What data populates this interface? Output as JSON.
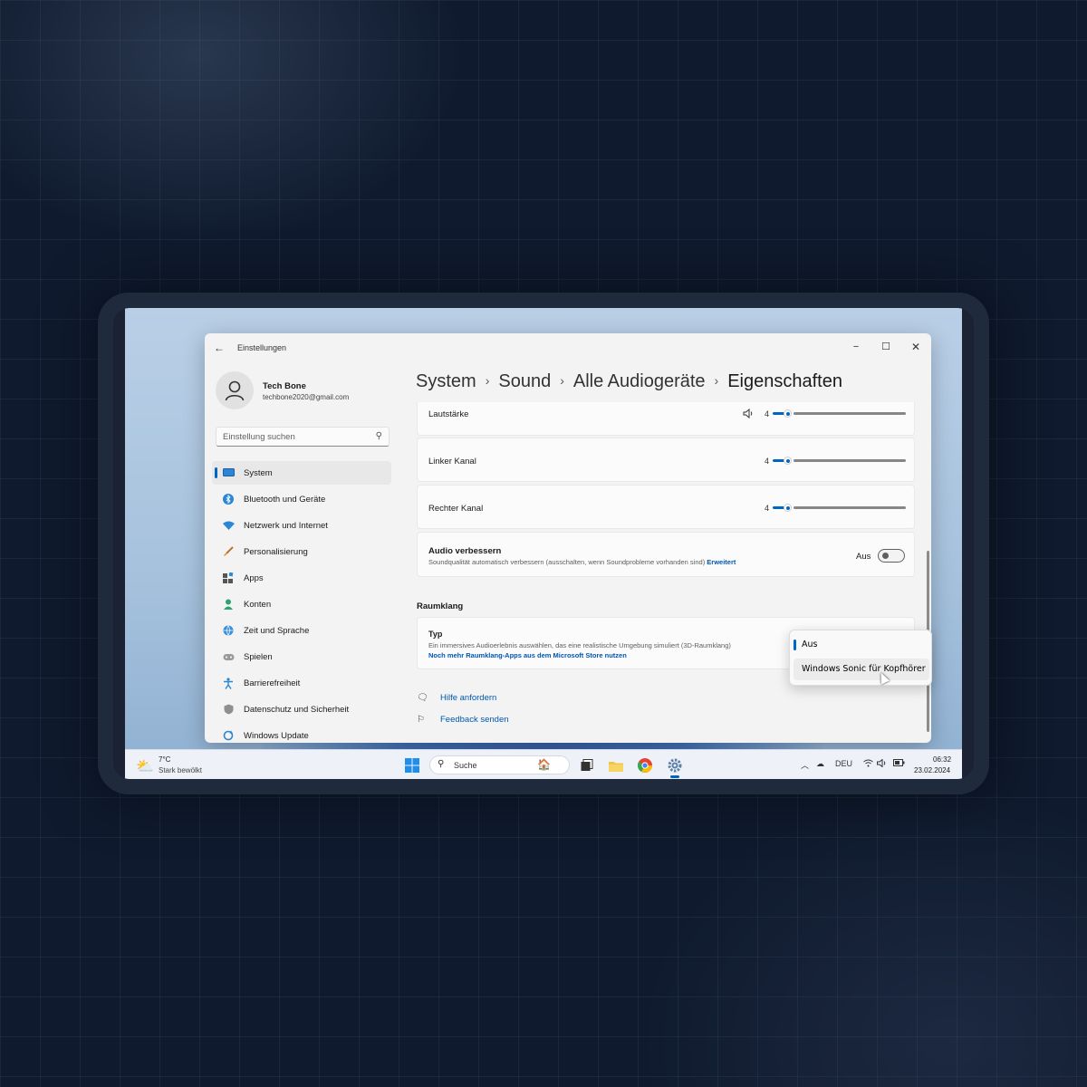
{
  "window": {
    "app_title": "Einstellungen",
    "back_icon": "back-arrow-icon",
    "controls": {
      "minimize": "−",
      "maximize": "☐",
      "close": "✕"
    }
  },
  "user": {
    "name": "Tech Bone",
    "email": "techbone2020@gmail.com"
  },
  "search": {
    "placeholder": "Einstellung suchen"
  },
  "sidebar": {
    "items": [
      {
        "label": "System",
        "icon": "monitor-icon",
        "active": true
      },
      {
        "label": "Bluetooth und Geräte",
        "icon": "bluetooth-icon"
      },
      {
        "label": "Netzwerk und Internet",
        "icon": "wifi-icon"
      },
      {
        "label": "Personalisierung",
        "icon": "brush-icon"
      },
      {
        "label": "Apps",
        "icon": "apps-icon"
      },
      {
        "label": "Konten",
        "icon": "person-icon"
      },
      {
        "label": "Zeit und Sprache",
        "icon": "globe-clock-icon"
      },
      {
        "label": "Spielen",
        "icon": "gamepad-icon"
      },
      {
        "label": "Barrierefreiheit",
        "icon": "accessibility-icon"
      },
      {
        "label": "Datenschutz und Sicherheit",
        "icon": "shield-icon"
      },
      {
        "label": "Windows Update",
        "icon": "update-icon"
      }
    ]
  },
  "breadcrumb": {
    "items": [
      "System",
      "Sound",
      "Alle Audiogeräte"
    ],
    "current": "Eigenschaften",
    "separator": "›"
  },
  "settings": {
    "volume": {
      "label": "Lautstärke",
      "value": "4",
      "level": 0.04
    },
    "left_channel": {
      "label": "Linker Kanal",
      "value": "4",
      "level": 0.04
    },
    "right_channel": {
      "label": "Rechter Kanal",
      "value": "4",
      "level": 0.04
    },
    "enhance": {
      "title": "Audio verbessern",
      "description": "Soundqualität automatisch verbessern (ausschalten, wenn Soundprobleme vorhanden sind)",
      "link": "Erweitert",
      "state_label": "Aus",
      "enabled": false
    }
  },
  "spatial": {
    "section_title": "Raumklang",
    "type_title": "Typ",
    "type_description": "Ein immersives Audioerlebnis auswählen, das eine realistische Umgebung simuliert (3D-Raumklang)",
    "store_link": "Noch mehr Raumklang-Apps aus dem Microsoft Store nutzen",
    "options": [
      "Aus",
      "Windows Sonic für Kopfhörer"
    ],
    "selected": "Aus"
  },
  "help": {
    "get_help": "Hilfe anfordern",
    "feedback": "Feedback senden"
  },
  "taskbar": {
    "weather_temp": "7°C",
    "weather_condition": "Stark bewölkt",
    "search_label": "Suche",
    "language": "DEU",
    "time": "06:32",
    "date": "23.02.2024"
  },
  "colors": {
    "accent": "#0067c0",
    "link": "#0057b0"
  }
}
